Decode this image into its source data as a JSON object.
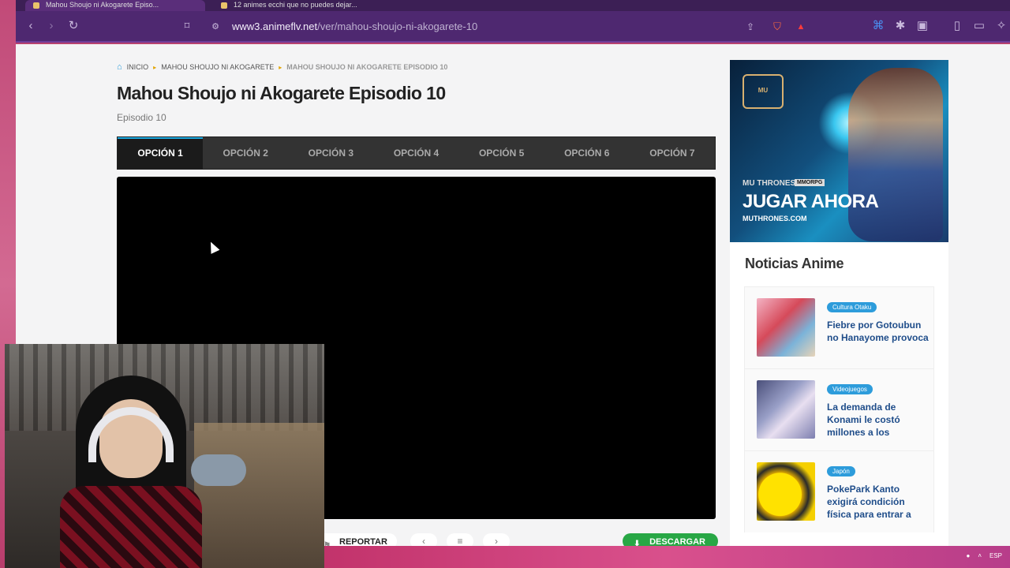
{
  "browser": {
    "tabs": [
      {
        "title": "Mahou Shoujo ni Akogarete Episo..."
      },
      {
        "title": "12 animes ecchi que no puedes dejar..."
      }
    ],
    "url": {
      "domain": "www3.animeflv.net",
      "path": "/ver/mahou-shoujo-ni-akogarete-10"
    }
  },
  "breadcrumb": {
    "home": "INICIO",
    "anime": "MAHOU SHOUJO NI AKOGARETE",
    "current": "MAHOU SHOUJO NI AKOGARETE EPISODIO 10"
  },
  "episode": {
    "title": "Mahou Shoujo ni Akogarete Episodio 10",
    "subtitle": "Episodio 10"
  },
  "options": [
    {
      "label": "OPCIÓN 1"
    },
    {
      "label": "OPCIÓN 2"
    },
    {
      "label": "OPCIÓN 3"
    },
    {
      "label": "OPCIÓN 4"
    },
    {
      "label": "OPCIÓN 5"
    },
    {
      "label": "OPCIÓN 6"
    },
    {
      "label": "OPCIÓN 7"
    }
  ],
  "actions": {
    "report": "REPORTAR",
    "download": "DESCARGAR"
  },
  "ad": {
    "brand": "MU THRONES",
    "tag": "MMORPG",
    "cta": "JUGAR AHORA",
    "url": "MUTHRONES.COM"
  },
  "news": {
    "title": "Noticias Anime",
    "items": [
      {
        "category": "Cultura Otaku",
        "headline": "Fiebre por Gotoubun no Hanayome provoca"
      },
      {
        "category": "Videojuegos",
        "headline": "La demanda de Konami le costó millones a los"
      },
      {
        "category": "Japón",
        "headline": "PokePark Kanto exigirá condición física para entrar a"
      }
    ]
  },
  "tray": {
    "lang": "ESP"
  }
}
